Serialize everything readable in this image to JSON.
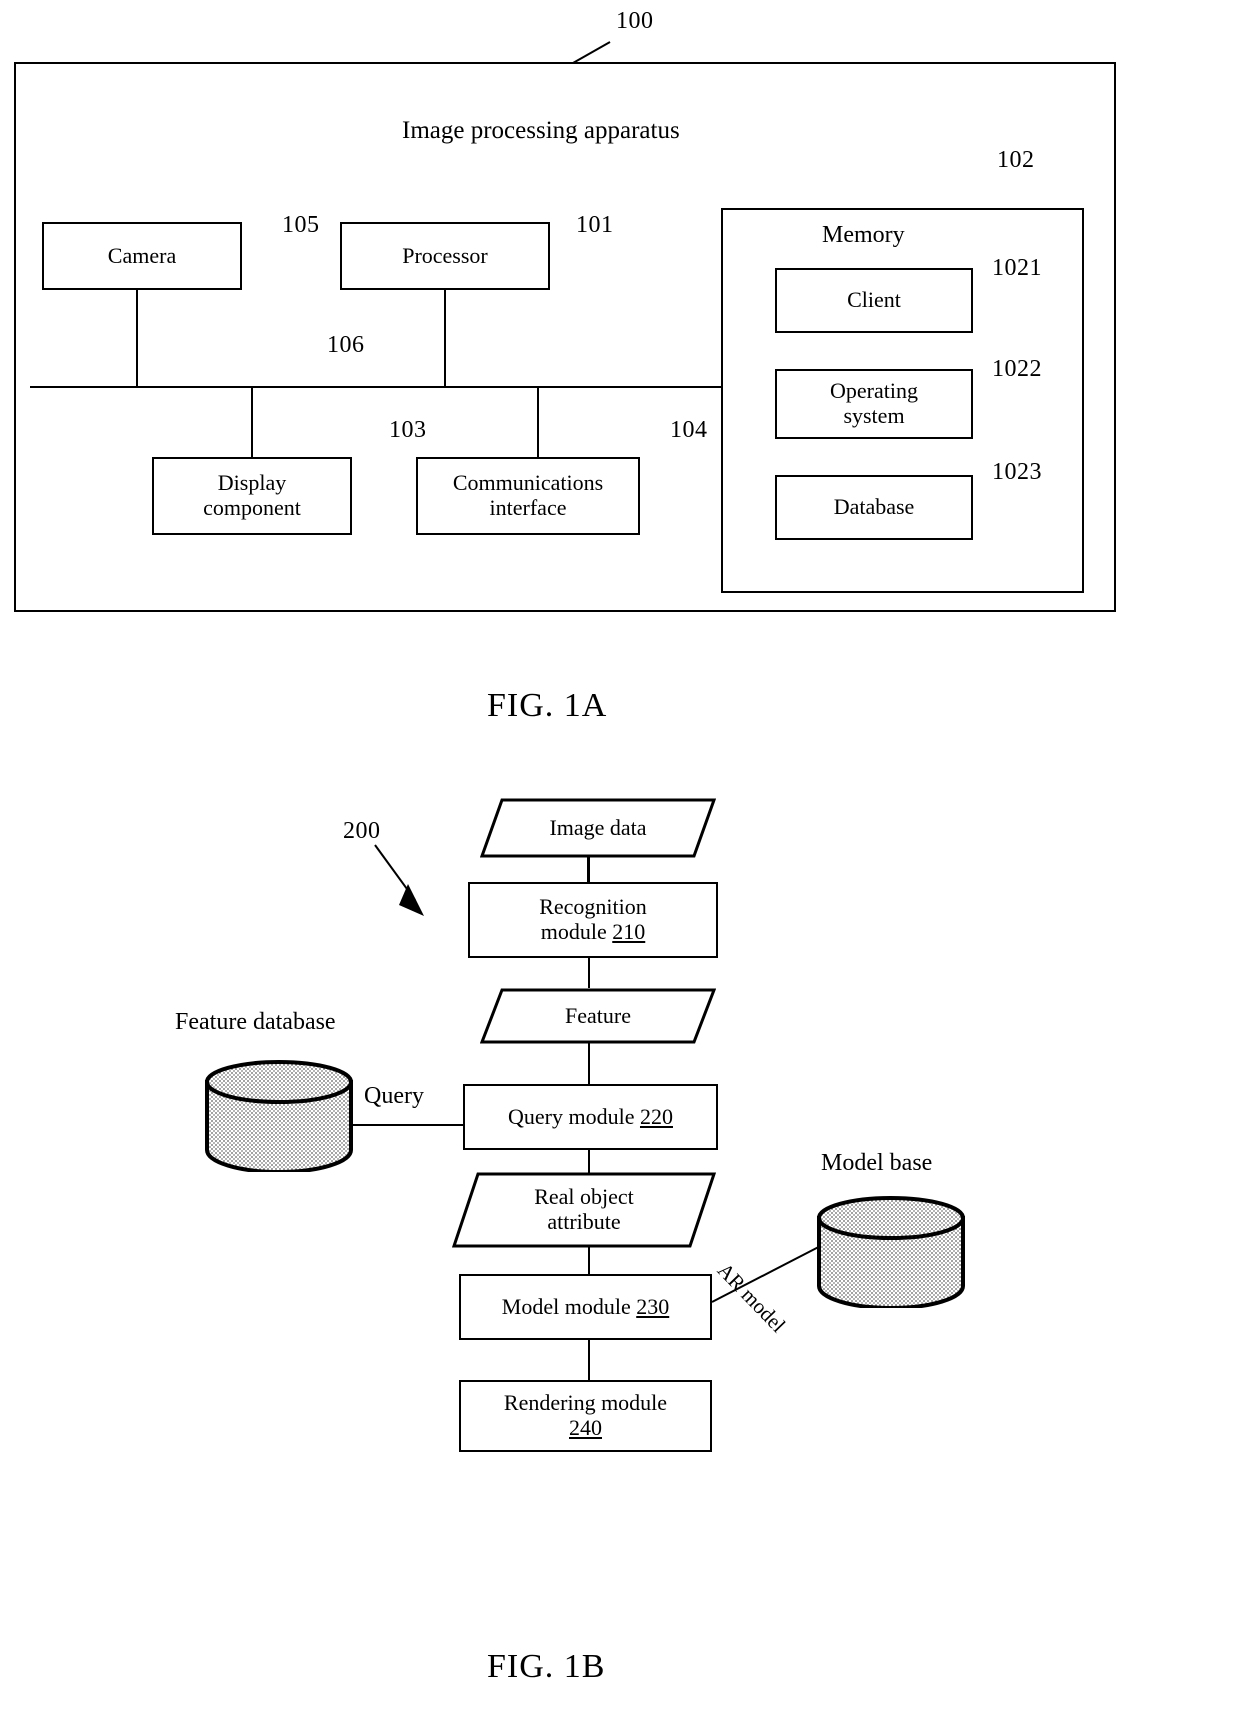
{
  "figures": [
    {
      "caption": "FIG. 1A",
      "ref": "100",
      "title": "Image processing apparatus",
      "blocks": [
        {
          "label": "Camera",
          "ref": "105"
        },
        {
          "label": "Processor",
          "ref": "101"
        },
        {
          "label": "Display component",
          "ref": "103"
        },
        {
          "label": "Communications interface",
          "ref": "104"
        },
        {
          "label": "Memory",
          "ref": "102"
        },
        {
          "label": "Client",
          "ref": "1021"
        },
        {
          "label": "Operating system",
          "ref": "1022"
        },
        {
          "label": "Database",
          "ref": "1023"
        }
      ],
      "bus_ref": "106"
    },
    {
      "caption": "FIG. 1B",
      "ref": "200",
      "nodes": [
        {
          "label": "Image data",
          "shape": "parallelogram"
        },
        {
          "label": "Recognition module",
          "num": "210",
          "shape": "rect"
        },
        {
          "label": "Feature",
          "shape": "parallelogram"
        },
        {
          "label": "Query module",
          "num": "220",
          "shape": "rect"
        },
        {
          "label": "Real object attribute",
          "shape": "parallelogram"
        },
        {
          "label": "Model module",
          "num": "230",
          "shape": "rect"
        },
        {
          "label": "Rendering module",
          "num": "240",
          "shape": "rect"
        },
        {
          "label": "Feature database",
          "shape": "cylinder"
        },
        {
          "label": "Model base",
          "shape": "cylinder"
        }
      ],
      "edge_labels": [
        "Query",
        "AR model"
      ]
    }
  ],
  "fig1a": {
    "caption": "FIG. 1A",
    "title": "Image processing apparatus",
    "ref_100": "100",
    "ref_105": "105",
    "ref_101": "101",
    "ref_106": "106",
    "ref_103": "103",
    "ref_104": "104",
    "ref_102": "102",
    "ref_1021": "1021",
    "ref_1022": "1022",
    "ref_1023": "1023",
    "camera": "Camera",
    "processor": "Processor",
    "display_line1": "Display",
    "display_line2": "component",
    "comms_line1": "Communications",
    "comms_line2": "interface",
    "memory": "Memory",
    "client": "Client",
    "os_line1": "Operating",
    "os_line2": "system",
    "database": "Database"
  },
  "fig1b": {
    "caption": "FIG. 1B",
    "ref_200": "200",
    "image_data": "Image data",
    "recognition_line1": "Recognition",
    "recognition_line2": "module",
    "recognition_num": "210",
    "feature": "Feature",
    "query_module": "Query module",
    "query_module_num": "220",
    "real_object_line1": "Real object",
    "real_object_line2": "attribute",
    "model_module": "Model module",
    "model_module_num": "230",
    "rendering_line1": "Rendering module",
    "rendering_num": "240",
    "feature_database": "Feature database",
    "model_base": "Model base",
    "query_label": "Query",
    "ar_model_label": "AR model"
  },
  "colors": {
    "ink": "#000000",
    "paper": "#ffffff",
    "cylinder_fill": "#d8d8d8"
  }
}
